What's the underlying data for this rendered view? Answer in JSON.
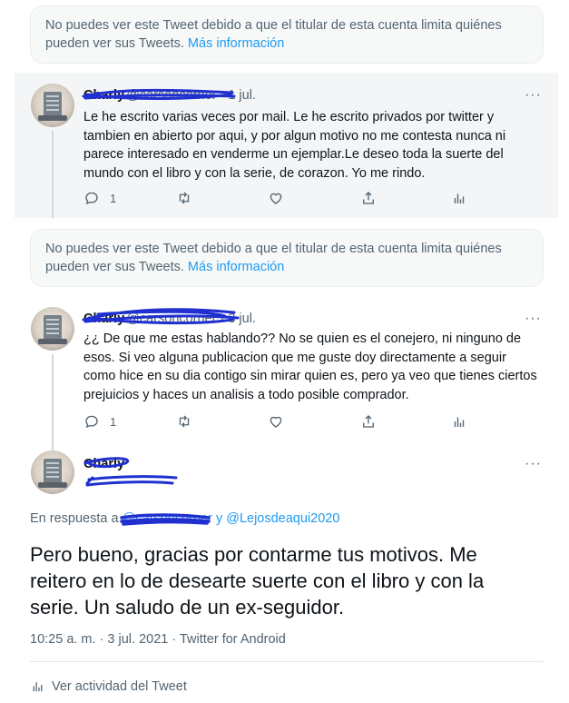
{
  "notices": [
    {
      "text": "No puedes ver este Tweet debido a que el titular de esta cuenta limita quiénes pueden ver sus Tweets.",
      "link": "Más información"
    },
    {
      "text": "No puedes ver este Tweet debido a que el titular de esta cuenta limita quiénes pueden ver sus Tweets.",
      "link": "Más información"
    }
  ],
  "tweets": [
    {
      "name": "Charly",
      "handle": "@carsoncorner",
      "date": "1 jul.",
      "text": "Le he escrito varias veces por mail. Le he escrito privados por twitter y tambien en abierto por aqui, y por algun motivo no me contesta nunca ni parece interesado en venderme un ejemplar.Le deseo toda la suerte del mundo con el libro y con la serie, de corazon. Yo me rindo.",
      "reply_count": "1",
      "more": "···"
    },
    {
      "name": "Charly",
      "handle": "@carsoncorner",
      "date": "3 jul.",
      "text": "¿¿ De que me estas hablando?? No se quien es el conejero, ni ninguno de esos. Si veo alguna publicacion que me guste doy directamente a seguir como hice en su dia contigo sin mirar quien es, pero ya veo que tienes ciertos prejuicios y haces un analisis a todo posible comprador.",
      "reply_count": "1",
      "more": "···"
    }
  ],
  "main_tweet": {
    "name": "Charly",
    "more": "···",
    "reply_prefix": "En respuesta a",
    "reply_hidden": "@carsoncorner",
    "reply_and": "y",
    "reply_user": "@Lejosdeaqui2020",
    "text": "Pero bueno, gracias por contarme tus motivos. Me reitero en lo de desearte suerte con el libro y con la serie. Un saludo de un ex-seguidor.",
    "time": "10:25 a. m. · 3 jul. 2021 · Twitter for Android",
    "activity": "Ver actividad del Tweet"
  },
  "colors": {
    "accent": "#1d9bf0",
    "secondary_text": "#536471",
    "scribble": "#1f2fd0"
  }
}
